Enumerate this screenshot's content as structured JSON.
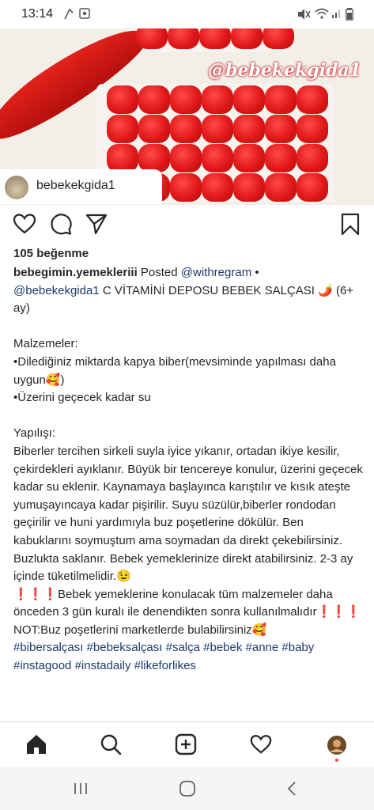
{
  "status_bar": {
    "time": "13:14"
  },
  "post": {
    "photo_watermark": "@bebekekgida1",
    "username": "bebekekgida1",
    "likes": "105 beğenme",
    "caption": {
      "author": "bebegimin.yemekleriii",
      "posted": "Posted",
      "mention_repost": "@withregram",
      "bullet": "•",
      "mention_original": "@bebekekgida1",
      "title": "C VİTAMİNİ DEPOSU BEBEK SALÇASI 🌶️ (6+ ay)",
      "ingredients_header": "Malzemeler:",
      "ingredient_1": "•Dilediğiniz miktarda kapya biber(mevsiminde yapılması daha uygun🥰)",
      "ingredient_2": "•Üzerini geçecek kadar su",
      "method_header": "Yapılışı:",
      "method_text": "Biberler tercihen sirkeli suyla iyice yıkanır, ortadan ikiye kesilir, çekirdekleri ayıklanır. Büyük bir tencereye konulur, üzerini geçecek kadar su eklenir. Kaynamaya başlayınca karıştılır ve kısık ateşte yumuşayıncaya kadar pişirilir. Suyu süzülür,biberler rondodan geçirilir ve huni yardımıyla buz poşetlerine dökülür. Ben kabuklarını soymuştum ama soymadan da direkt çekebilirsiniz. Buzlukta saklanır. Bebek yemeklerinize direkt atabilirsiniz. 2-3 ay içinde tüketilmelidir.😉",
      "warning_text": "❗❗❗Bebek yemeklerine konulacak tüm malzemeler daha önceden 3 gün kuralı ile denendikten sonra kullanılmalıdır❗❗❗ NOT:Buz poşetlerini marketlerde bulabilirsiniz🥰",
      "hashtags": "#bibersalçası #bebeksalçası #salça #bebek #anne #baby #instagood #instadaily #likeforlikes"
    }
  },
  "colors": {
    "link": "#1b3a6b",
    "notification_dot": "#ed4956"
  },
  "icons": {
    "action_bar": [
      "heart-icon",
      "comment-icon",
      "share-icon",
      "bookmark-icon"
    ],
    "bottom_nav": [
      "home-icon",
      "search-icon",
      "new-post-icon",
      "activity-heart-icon",
      "profile-avatar"
    ],
    "system_nav": [
      "recent-apps-icon",
      "home-circle-icon",
      "back-icon"
    ]
  }
}
